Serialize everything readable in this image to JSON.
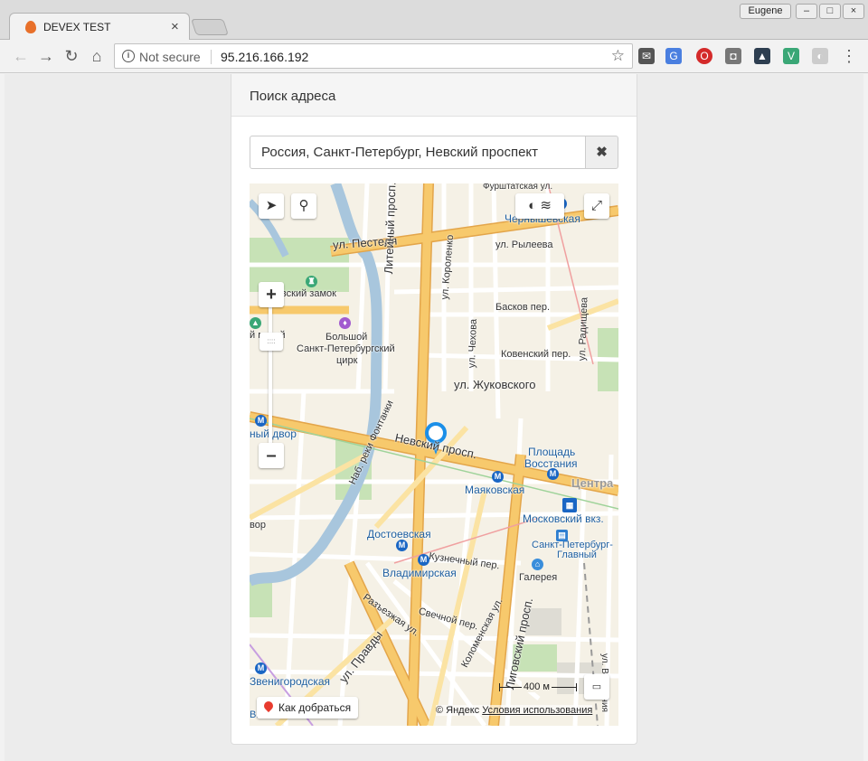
{
  "browser": {
    "tab_title": "DEVEX TEST",
    "tab_close": "×",
    "profile": "Eugene",
    "win_min": "–",
    "win_max": "□",
    "win_close": "×",
    "nav_back": "←",
    "nav_forward": "→",
    "nav_reload": "↻",
    "nav_home": "⌂",
    "security": "Not secure",
    "url": "95.216.166.192",
    "bookmark_star": "☆",
    "menu": "⋮"
  },
  "panel": {
    "title": "Поиск адреса",
    "address_value": "Россия, Санкт-Петербург, Невский проспект",
    "clear_label": "✖"
  },
  "map": {
    "route_label": "Как добраться",
    "copyright": "© Яндекс",
    "terms": "Условия использования",
    "scale": "400 м",
    "labels": {
      "pestelya": "ул. Пестеля",
      "rileeva": "ул. Рылеева",
      "liteyny": "Литейный просп.",
      "korolenko": "ул. Короленко",
      "baskov": "Басков пер.",
      "zamok": "айловский замок",
      "museum": "й музей",
      "circus1": "Большой",
      "circus2": "Санкт-Петербургский",
      "circus3": "цирк",
      "chekhova": "ул. Чехова",
      "kovensky": "Ковенский пер.",
      "radisheva": "ул. Радищева",
      "zhukovskogo": "ул. Жуковского",
      "fontanka": "Наб. реки Фонтанки",
      "nevsky": "Невский просп.",
      "gostiny": "ный двор",
      "vosstaniya1": "Площадь",
      "vosstaniya2": "Восстания",
      "mayakovskaya": "Маяковская",
      "centr": "Центра",
      "moskovsky": "Московский вкз.",
      "spb_glavny1": "Санкт-Петербург-",
      "spb_glavny2": "Главный",
      "dostoevskaya": "Достоевская",
      "kuznechny": "Кузнечный пер.",
      "vladimirskaya": "Владимирская",
      "galereya": "Галерея",
      "razezzhaya": "Разъезжая ул.",
      "svechnoy": "Свечной пер.",
      "ligovsky": "Лиговский просп.",
      "pravdy": "ул. Правды",
      "kolomenskaya": "Коломенская ул.",
      "zvenigorodskaya": "Звенигородская",
      "vitebsky": "Витебский вкз.",
      "chernyshevskaya": "Чернышевская",
      "furshtatskaya": "Фурштатская ул.",
      "vor": "вор",
      "vosstaniya_street": "ул. Восстания"
    }
  },
  "colors": {
    "road_major": "#f7c96c",
    "road_major_border": "#e3a54a",
    "road_minor": "#ffffff",
    "water": "#a8c6dd",
    "park": "#c7e2b6",
    "metro": "#1a66c4",
    "marker": "#1b8fe8"
  }
}
